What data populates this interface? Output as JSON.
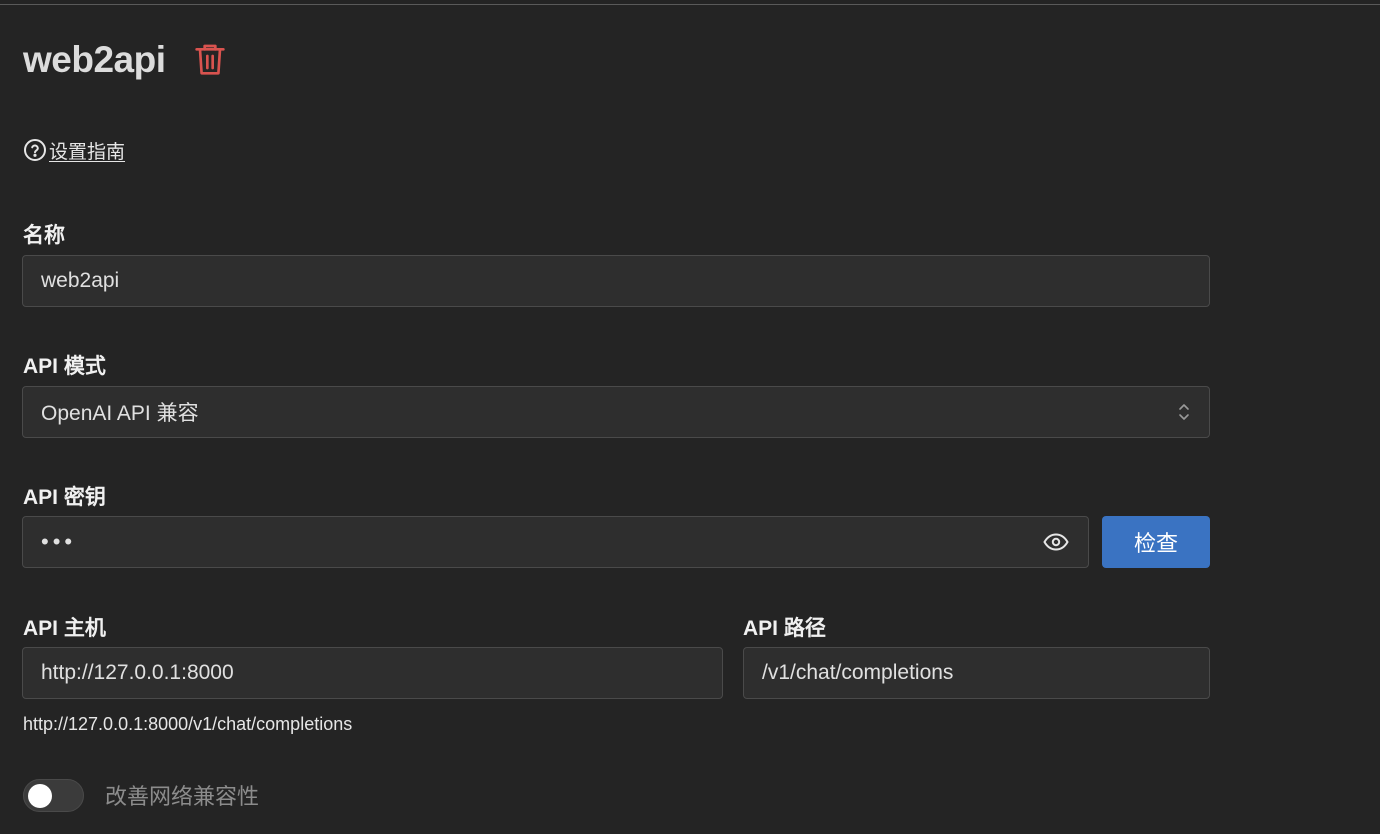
{
  "header": {
    "title": "web2api",
    "delete_icon": "trash-icon",
    "delete_color": "#d9534f"
  },
  "guide": {
    "icon": "question-circle-icon",
    "label": "设置指南"
  },
  "form": {
    "name": {
      "label": "名称",
      "value": "web2api"
    },
    "api_mode": {
      "label": "API 模式",
      "selected": "OpenAI API 兼容"
    },
    "api_key": {
      "label": "API 密钥",
      "value": "•••",
      "check_label": "检查"
    },
    "api_host": {
      "label": "API 主机",
      "value": "http://127.0.0.1:8000"
    },
    "api_path": {
      "label": "API 路径",
      "value": "/v1/chat/completions"
    },
    "full_url": "http://127.0.0.1:8000/v1/chat/completions",
    "network_compat": {
      "label": "改善网络兼容性",
      "enabled": false
    }
  },
  "colors": {
    "background": "#242424",
    "accent": "#3a73c2",
    "danger": "#d9534f"
  }
}
